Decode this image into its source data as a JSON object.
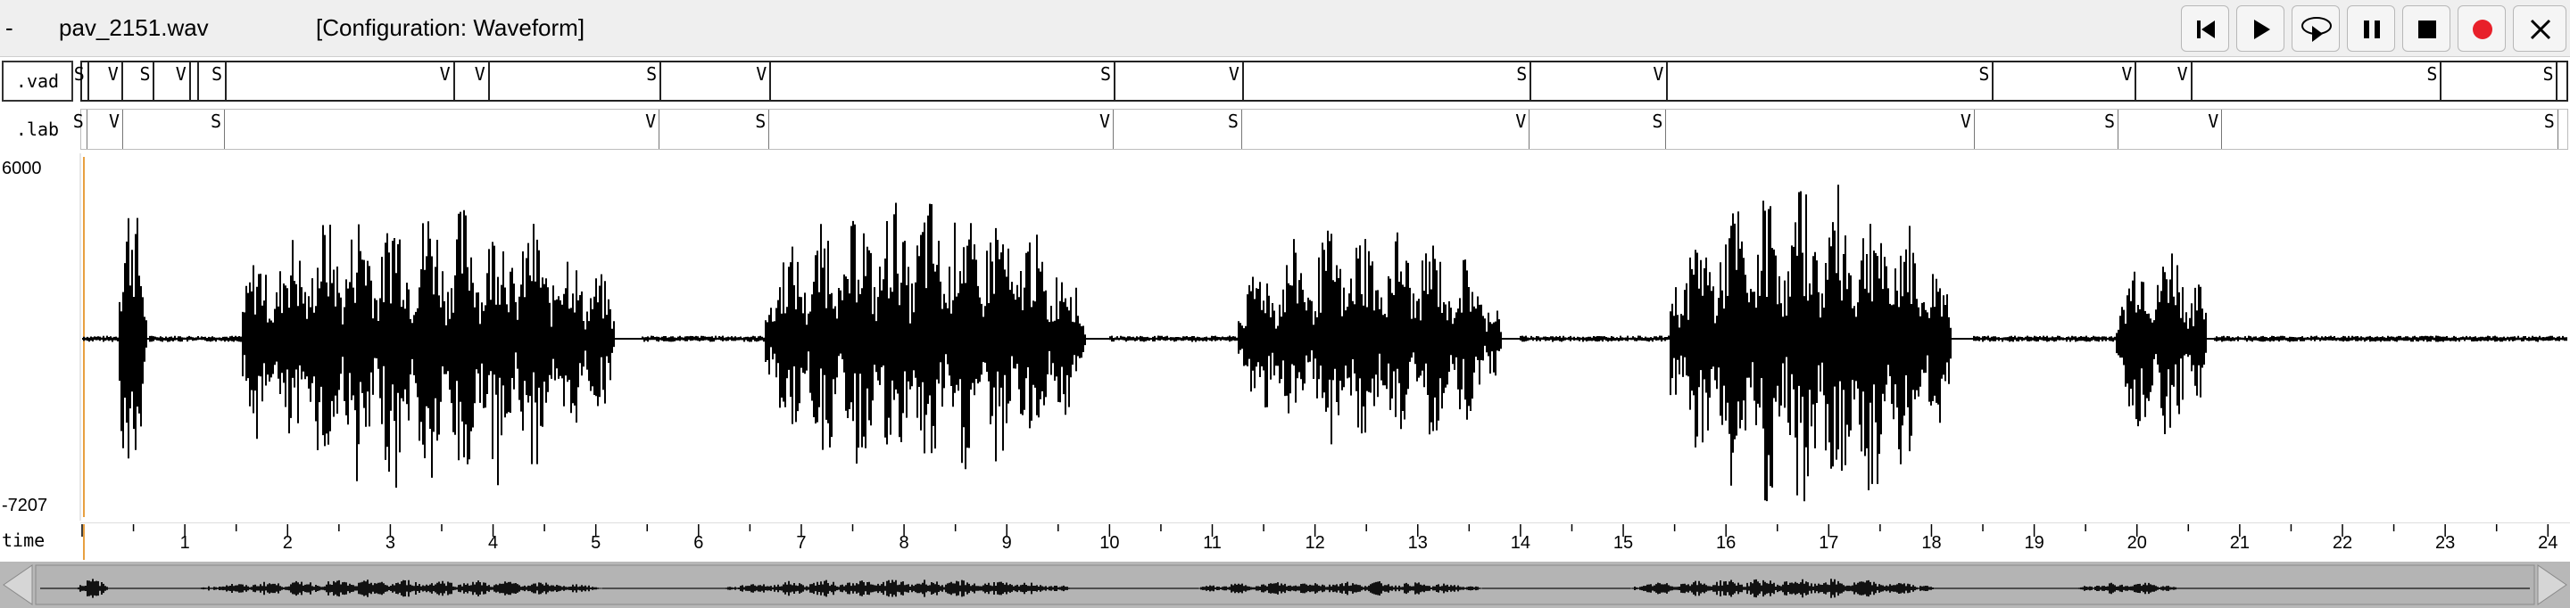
{
  "titlebar": {
    "menu": "-",
    "filename": "pav_2151.wav",
    "configuration": "[Configuration: Waveform]"
  },
  "controls": [
    {
      "name": "skip-to-start-button",
      "icon": "skip-start-icon"
    },
    {
      "name": "play-button",
      "icon": "play-icon"
    },
    {
      "name": "loop-play-button",
      "icon": "loop-play-icon"
    },
    {
      "name": "pause-button",
      "icon": "pause-icon"
    },
    {
      "name": "stop-button",
      "icon": "stop-icon"
    },
    {
      "name": "record-button",
      "icon": "record-icon",
      "color": "#e8202a"
    },
    {
      "name": "close-button",
      "icon": "close-icon"
    }
  ],
  "tiers": {
    "vad": {
      "label": ".vad",
      "marks": [
        {
          "t": 0.05,
          "label": "S"
        },
        {
          "t": 0.38,
          "label": "V"
        },
        {
          "t": 0.69,
          "label": "S"
        },
        {
          "t": 1.04,
          "label": "V"
        },
        {
          "t": 1.12,
          "label": ""
        },
        {
          "t": 1.39,
          "label": "S"
        },
        {
          "t": 3.61,
          "label": "V"
        },
        {
          "t": 3.95,
          "label": "V"
        },
        {
          "t": 5.62,
          "label": "S"
        },
        {
          "t": 6.69,
          "label": "V"
        },
        {
          "t": 10.04,
          "label": "S"
        },
        {
          "t": 11.29,
          "label": "V"
        },
        {
          "t": 14.09,
          "label": "S"
        },
        {
          "t": 15.42,
          "label": "V"
        },
        {
          "t": 18.59,
          "label": "S"
        },
        {
          "t": 19.98,
          "label": "V"
        },
        {
          "t": 20.52,
          "label": "V"
        },
        {
          "t": 22.95,
          "label": "S"
        },
        {
          "t": 24.08,
          "label": "S"
        }
      ]
    },
    "lab": {
      "label": ".lab",
      "marks": [
        {
          "t": 0.05,
          "label": "S"
        },
        {
          "t": 0.4,
          "label": "V"
        },
        {
          "t": 1.39,
          "label": "S"
        },
        {
          "t": 5.62,
          "label": "V"
        },
        {
          "t": 6.69,
          "label": "S"
        },
        {
          "t": 10.04,
          "label": "V"
        },
        {
          "t": 11.29,
          "label": "S"
        },
        {
          "t": 14.09,
          "label": "V"
        },
        {
          "t": 15.42,
          "label": "S"
        },
        {
          "t": 18.42,
          "label": "V"
        },
        {
          "t": 19.82,
          "label": "S"
        },
        {
          "t": 20.83,
          "label": "V"
        },
        {
          "t": 24.1,
          "label": "S"
        }
      ]
    }
  },
  "waveform": {
    "y_max_label": "6000",
    "y_min_label": "-7207",
    "segments": [
      [
        0.35,
        0.65,
        0.92,
        0.96
      ],
      [
        1.55,
        5.45,
        0.85,
        0.9
      ],
      [
        6.65,
        10.0,
        0.88,
        0.82
      ],
      [
        11.25,
        14.0,
        0.7,
        0.65
      ],
      [
        15.45,
        18.4,
        0.95,
        1.0
      ],
      [
        19.8,
        20.75,
        0.6,
        0.62
      ]
    ],
    "color": "#000000",
    "cursor_color": "#e8a040"
  },
  "time_axis": {
    "label": "time",
    "ticks": [
      "1",
      "2",
      "3",
      "4",
      "5",
      "6",
      "7",
      "8",
      "9",
      "10",
      "11",
      "12",
      "13",
      "14",
      "15",
      "16",
      "17",
      "18",
      "19",
      "20",
      "21",
      "22",
      "23",
      "24"
    ],
    "start": 0,
    "end": 24.18
  }
}
